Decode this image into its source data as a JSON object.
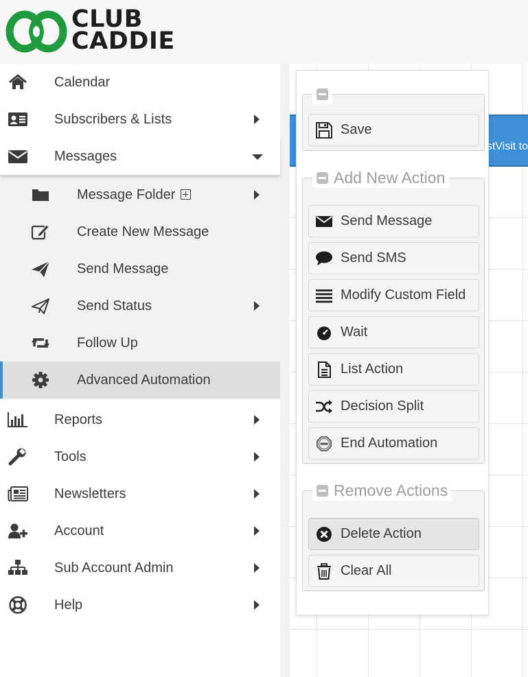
{
  "brand": {
    "line1": "CLUB",
    "line2": "CADDIE",
    "logo_green": "#1f9a3c"
  },
  "sidebar": {
    "items": [
      {
        "label": "Calendar",
        "icon": "home-icon"
      },
      {
        "label": "Subscribers & Lists",
        "icon": "address-card-icon",
        "has_submenu": true
      },
      {
        "label": "Messages",
        "icon": "envelope-icon",
        "expanded": true
      }
    ],
    "messages_submenu": [
      {
        "label": "Message Folder",
        "icon": "folder-icon",
        "has_submenu": true,
        "add_icon": "plus-square-icon"
      },
      {
        "label": "Create New Message",
        "icon": "edit-icon"
      },
      {
        "label": "Send Message",
        "icon": "paper-plane-icon"
      },
      {
        "label": "Send Status",
        "icon": "paper-plane-outline-icon",
        "has_submenu": true
      },
      {
        "label": "Follow Up",
        "icon": "retweet-icon"
      },
      {
        "label": "Advanced Automation",
        "icon": "gear-icon",
        "active": true
      }
    ],
    "lower_items": [
      {
        "label": "Reports",
        "icon": "bar-chart-icon",
        "has_submenu": true
      },
      {
        "label": "Tools",
        "icon": "wrench-icon",
        "has_submenu": true
      },
      {
        "label": "Newsletters",
        "icon": "newspaper-icon",
        "has_submenu": true
      },
      {
        "label": "Account",
        "icon": "user-plus-icon",
        "has_submenu": true
      },
      {
        "label": "Sub Account Admin",
        "icon": "sitemap-icon",
        "has_submenu": true
      },
      {
        "label": "Help",
        "icon": "life-ring-icon",
        "has_submenu": true
      }
    ],
    "active_accent": "#3d8fd6"
  },
  "canvas": {
    "node_text": "stVisit to",
    "node_color": "#3d8fd6"
  },
  "panel": {
    "save_group": {
      "title": "",
      "buttons": [
        {
          "label": "Save",
          "icon": "floppy-disk-icon"
        }
      ]
    },
    "add_group": {
      "title": "Add New Action",
      "buttons": [
        {
          "label": "Send Message",
          "icon": "envelope-icon"
        },
        {
          "label": "Send SMS",
          "icon": "speech-bubble-icon"
        },
        {
          "label": "Modify Custom Field",
          "icon": "list-lines-icon"
        },
        {
          "label": "Wait",
          "icon": "clock-icon"
        },
        {
          "label": "List Action",
          "icon": "document-icon"
        },
        {
          "label": "Decision Split",
          "icon": "shuffle-icon"
        },
        {
          "label": "End Automation",
          "icon": "stop-sign-icon"
        }
      ]
    },
    "remove_group": {
      "title": "Remove Actions",
      "buttons": [
        {
          "label": "Delete Action",
          "icon": "times-circle-icon",
          "pressed": true
        },
        {
          "label": "Clear All",
          "icon": "trash-icon"
        }
      ]
    }
  }
}
